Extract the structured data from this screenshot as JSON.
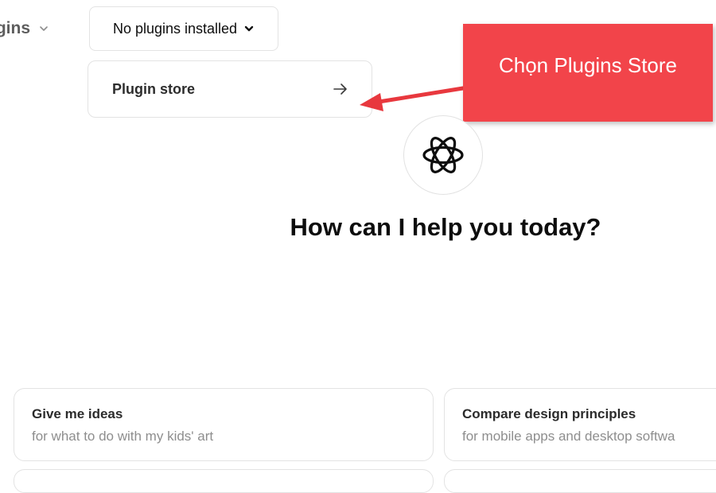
{
  "header": {
    "model_label": "ugins",
    "plugins_dropdown_label": "No plugins installed"
  },
  "dropdown_menu": {
    "item_label": "Plugin store"
  },
  "annotation": {
    "callout_text": "Chọn Plugins Store",
    "color": "#f2444a"
  },
  "main": {
    "headline": "How can I help you today?"
  },
  "suggestions": [
    {
      "title": "Give me ideas",
      "subtitle": "for what to do with my kids' art"
    },
    {
      "title": "Compare design principles",
      "subtitle": "for mobile apps and desktop softwa"
    }
  ],
  "icons": {
    "model_caret": "chevron-down-icon",
    "dropdown_caret": "chevron-down-icon",
    "store_arrow": "arrow-right-icon",
    "logo": "openai-logo-icon"
  }
}
